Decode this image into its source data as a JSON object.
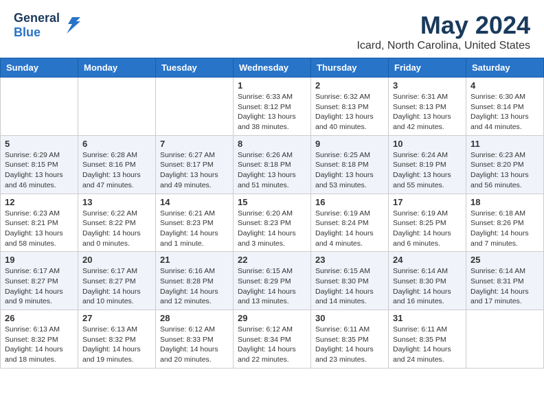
{
  "header": {
    "logo_general": "General",
    "logo_blue": "Blue",
    "main_title": "May 2024",
    "subtitle": "Icard, North Carolina, United States"
  },
  "weekdays": [
    "Sunday",
    "Monday",
    "Tuesday",
    "Wednesday",
    "Thursday",
    "Friday",
    "Saturday"
  ],
  "weeks": [
    [
      {
        "day": "",
        "info": ""
      },
      {
        "day": "",
        "info": ""
      },
      {
        "day": "",
        "info": ""
      },
      {
        "day": "1",
        "info": "Sunrise: 6:33 AM\nSunset: 8:12 PM\nDaylight: 13 hours\nand 38 minutes."
      },
      {
        "day": "2",
        "info": "Sunrise: 6:32 AM\nSunset: 8:13 PM\nDaylight: 13 hours\nand 40 minutes."
      },
      {
        "day": "3",
        "info": "Sunrise: 6:31 AM\nSunset: 8:13 PM\nDaylight: 13 hours\nand 42 minutes."
      },
      {
        "day": "4",
        "info": "Sunrise: 6:30 AM\nSunset: 8:14 PM\nDaylight: 13 hours\nand 44 minutes."
      }
    ],
    [
      {
        "day": "5",
        "info": "Sunrise: 6:29 AM\nSunset: 8:15 PM\nDaylight: 13 hours\nand 46 minutes."
      },
      {
        "day": "6",
        "info": "Sunrise: 6:28 AM\nSunset: 8:16 PM\nDaylight: 13 hours\nand 47 minutes."
      },
      {
        "day": "7",
        "info": "Sunrise: 6:27 AM\nSunset: 8:17 PM\nDaylight: 13 hours\nand 49 minutes."
      },
      {
        "day": "8",
        "info": "Sunrise: 6:26 AM\nSunset: 8:18 PM\nDaylight: 13 hours\nand 51 minutes."
      },
      {
        "day": "9",
        "info": "Sunrise: 6:25 AM\nSunset: 8:18 PM\nDaylight: 13 hours\nand 53 minutes."
      },
      {
        "day": "10",
        "info": "Sunrise: 6:24 AM\nSunset: 8:19 PM\nDaylight: 13 hours\nand 55 minutes."
      },
      {
        "day": "11",
        "info": "Sunrise: 6:23 AM\nSunset: 8:20 PM\nDaylight: 13 hours\nand 56 minutes."
      }
    ],
    [
      {
        "day": "12",
        "info": "Sunrise: 6:23 AM\nSunset: 8:21 PM\nDaylight: 13 hours\nand 58 minutes."
      },
      {
        "day": "13",
        "info": "Sunrise: 6:22 AM\nSunset: 8:22 PM\nDaylight: 14 hours\nand 0 minutes."
      },
      {
        "day": "14",
        "info": "Sunrise: 6:21 AM\nSunset: 8:23 PM\nDaylight: 14 hours\nand 1 minute."
      },
      {
        "day": "15",
        "info": "Sunrise: 6:20 AM\nSunset: 8:23 PM\nDaylight: 14 hours\nand 3 minutes."
      },
      {
        "day": "16",
        "info": "Sunrise: 6:19 AM\nSunset: 8:24 PM\nDaylight: 14 hours\nand 4 minutes."
      },
      {
        "day": "17",
        "info": "Sunrise: 6:19 AM\nSunset: 8:25 PM\nDaylight: 14 hours\nand 6 minutes."
      },
      {
        "day": "18",
        "info": "Sunrise: 6:18 AM\nSunset: 8:26 PM\nDaylight: 14 hours\nand 7 minutes."
      }
    ],
    [
      {
        "day": "19",
        "info": "Sunrise: 6:17 AM\nSunset: 8:27 PM\nDaylight: 14 hours\nand 9 minutes."
      },
      {
        "day": "20",
        "info": "Sunrise: 6:17 AM\nSunset: 8:27 PM\nDaylight: 14 hours\nand 10 minutes."
      },
      {
        "day": "21",
        "info": "Sunrise: 6:16 AM\nSunset: 8:28 PM\nDaylight: 14 hours\nand 12 minutes."
      },
      {
        "day": "22",
        "info": "Sunrise: 6:15 AM\nSunset: 8:29 PM\nDaylight: 14 hours\nand 13 minutes."
      },
      {
        "day": "23",
        "info": "Sunrise: 6:15 AM\nSunset: 8:30 PM\nDaylight: 14 hours\nand 14 minutes."
      },
      {
        "day": "24",
        "info": "Sunrise: 6:14 AM\nSunset: 8:30 PM\nDaylight: 14 hours\nand 16 minutes."
      },
      {
        "day": "25",
        "info": "Sunrise: 6:14 AM\nSunset: 8:31 PM\nDaylight: 14 hours\nand 17 minutes."
      }
    ],
    [
      {
        "day": "26",
        "info": "Sunrise: 6:13 AM\nSunset: 8:32 PM\nDaylight: 14 hours\nand 18 minutes."
      },
      {
        "day": "27",
        "info": "Sunrise: 6:13 AM\nSunset: 8:32 PM\nDaylight: 14 hours\nand 19 minutes."
      },
      {
        "day": "28",
        "info": "Sunrise: 6:12 AM\nSunset: 8:33 PM\nDaylight: 14 hours\nand 20 minutes."
      },
      {
        "day": "29",
        "info": "Sunrise: 6:12 AM\nSunset: 8:34 PM\nDaylight: 14 hours\nand 22 minutes."
      },
      {
        "day": "30",
        "info": "Sunrise: 6:11 AM\nSunset: 8:35 PM\nDaylight: 14 hours\nand 23 minutes."
      },
      {
        "day": "31",
        "info": "Sunrise: 6:11 AM\nSunset: 8:35 PM\nDaylight: 14 hours\nand 24 minutes."
      },
      {
        "day": "",
        "info": ""
      }
    ]
  ]
}
